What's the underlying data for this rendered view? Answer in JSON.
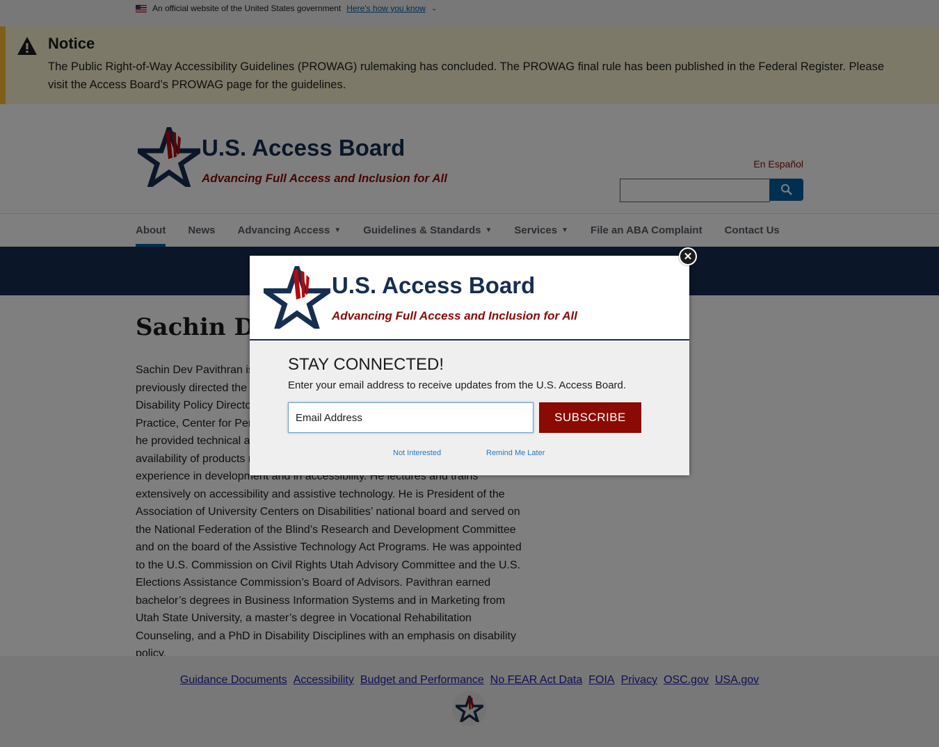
{
  "gov_banner": {
    "text": "An official website of the United States government",
    "link": "Here's how you know"
  },
  "notice": {
    "title": "Notice",
    "text": "The Public Right-of-Way Accessibility Guidelines (PROWAG) rulemaking has concluded. The PROWAG final rule has been published in the Federal Register. Please visit the Access Board’s PROWAG page for the guidelines."
  },
  "header": {
    "site_title": "U.S. Access Board",
    "tagline": "Advancing Full Access and Inclusion for All",
    "language_link": "En Español",
    "search_icon": "search-icon"
  },
  "nav": {
    "items": [
      {
        "label": "About",
        "active": true,
        "dropdown": false
      },
      {
        "label": "News",
        "active": false,
        "dropdown": false
      },
      {
        "label": "Advancing Access",
        "active": false,
        "dropdown": true
      },
      {
        "label": "Guidelines & Standards",
        "active": false,
        "dropdown": true
      },
      {
        "label": "Services",
        "active": false,
        "dropdown": true
      },
      {
        "label": "File an ABA Complaint",
        "active": false,
        "dropdown": false
      },
      {
        "label": "Contact Us",
        "active": false,
        "dropdown": false
      }
    ]
  },
  "main": {
    "page_title": "Sachin Dev Pavithran",
    "bio": "Sachin Dev Pavithran is Executive Director of the U.S. Access Board. He previously directed the Utah Assistive Technology Program and was the Disability Policy Director at the Institute for Disability Research, Policy & Practice, Center for Persons with Disabilities, at Utah State University, where he provided technical assistance on accessible technology and on the availability of products related to assistive technology. He has over 20 years of experience in development and in accessibility. He lectures and trains extensively on accessibility and assistive technology. He is President of the Association of University Centers on Disabilities’ national board and served on the National Federation of the Blind’s Research and Development Committee and on the board of the Assistive Technology Act Programs. He was appointed to the U.S. Commission on Civil Rights Utah Advisory Committee and the U.S. Elections Assistance Commission’s Board of Advisors. Pavithran earned bachelor’s degrees in Business Information Systems and in Marketing from Utah State University, a master’s degree in Vocational Rehabilitation Counseling, and a PhD in Disability Disciplines with an emphasis on disability policy."
  },
  "footer": {
    "links": [
      "Guidance Documents",
      "Accessibility",
      "Budget and Performance",
      "No FEAR Act Data",
      "FOIA",
      "Privacy",
      "OSC.gov",
      "USA.gov"
    ]
  },
  "modal": {
    "site_title": "U.S. Access Board",
    "tagline": "Advancing Full Access and Inclusion for All",
    "heading": "STAY CONNECTED!",
    "subtext": "Enter your email address to receive updates from the U.S. Access Board.",
    "email_placeholder": "Email Address",
    "subscribe_label": "SUBSCRIBE",
    "not_interested": "Not Interested",
    "remind_later": "Remind Me Later",
    "close_icon": "close-icon"
  },
  "colors": {
    "navy": "#162e51",
    "brand_red": "#8b0a03",
    "link_blue": "#005ea2",
    "notice_bg": "#faf3d1",
    "notice_border": "#ffbe2e"
  }
}
